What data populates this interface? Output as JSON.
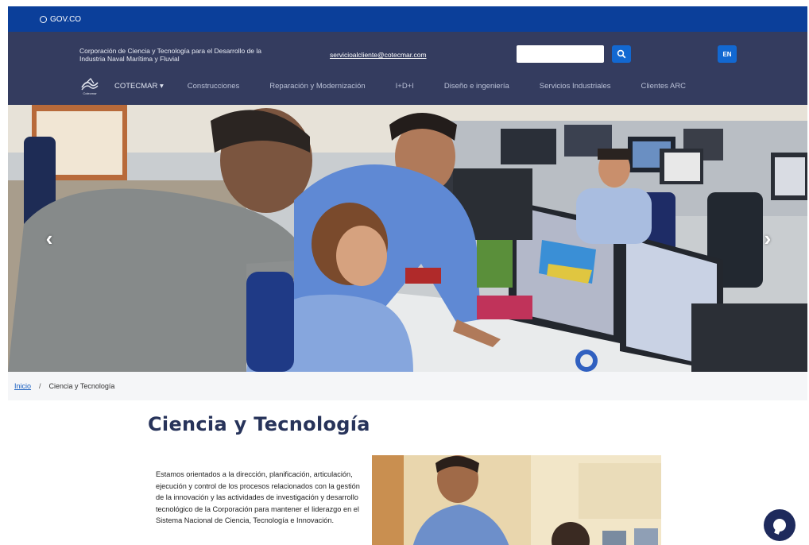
{
  "govbar": {
    "label": "GOV.CO"
  },
  "header": {
    "org_name": "Corporación de Ciencia y Tecnología para el Desarrollo de la Industria Naval Marítima y Fluvial",
    "email": "servicioalcliente@cotecmar.com",
    "search": {
      "value": "",
      "placeholder": ""
    },
    "lang_label": "EN",
    "logo_caption": "Cotecmar"
  },
  "nav": {
    "items": [
      {
        "label": "COTECMAR ▾"
      },
      {
        "label": "Construcciones"
      },
      {
        "label": "Reparación y Modernización"
      },
      {
        "label": "I+D+I"
      },
      {
        "label": "Diseño e ingeniería"
      },
      {
        "label": "Servicios Industriales"
      },
      {
        "label": "Clientes ARC"
      }
    ]
  },
  "hero": {
    "prev_icon": "chevron-left-icon",
    "next_icon": "chevron-right-icon"
  },
  "breadcrumb": {
    "home": "Inicio",
    "separator": "/",
    "current": "Ciencia y Tecnología"
  },
  "main": {
    "title": "Ciencia y Tecnología",
    "paragraph": "Estamos orientados a la dirección, planificación, articulación, ejecución y control de los procesos relacionados con la gestión de la innovación y las actividades de investigación y desarrollo tecnológico de la Corporación para mantener el liderazgo en el Sistema Nacional de Ciencia, Tecnología e Innovación."
  },
  "colors": {
    "gov_blue": "#0b3f9a",
    "header_navy": "#343c5f",
    "accent_blue": "#1268d1",
    "title_navy": "#27335a",
    "chat_navy": "#1e2a5c"
  }
}
